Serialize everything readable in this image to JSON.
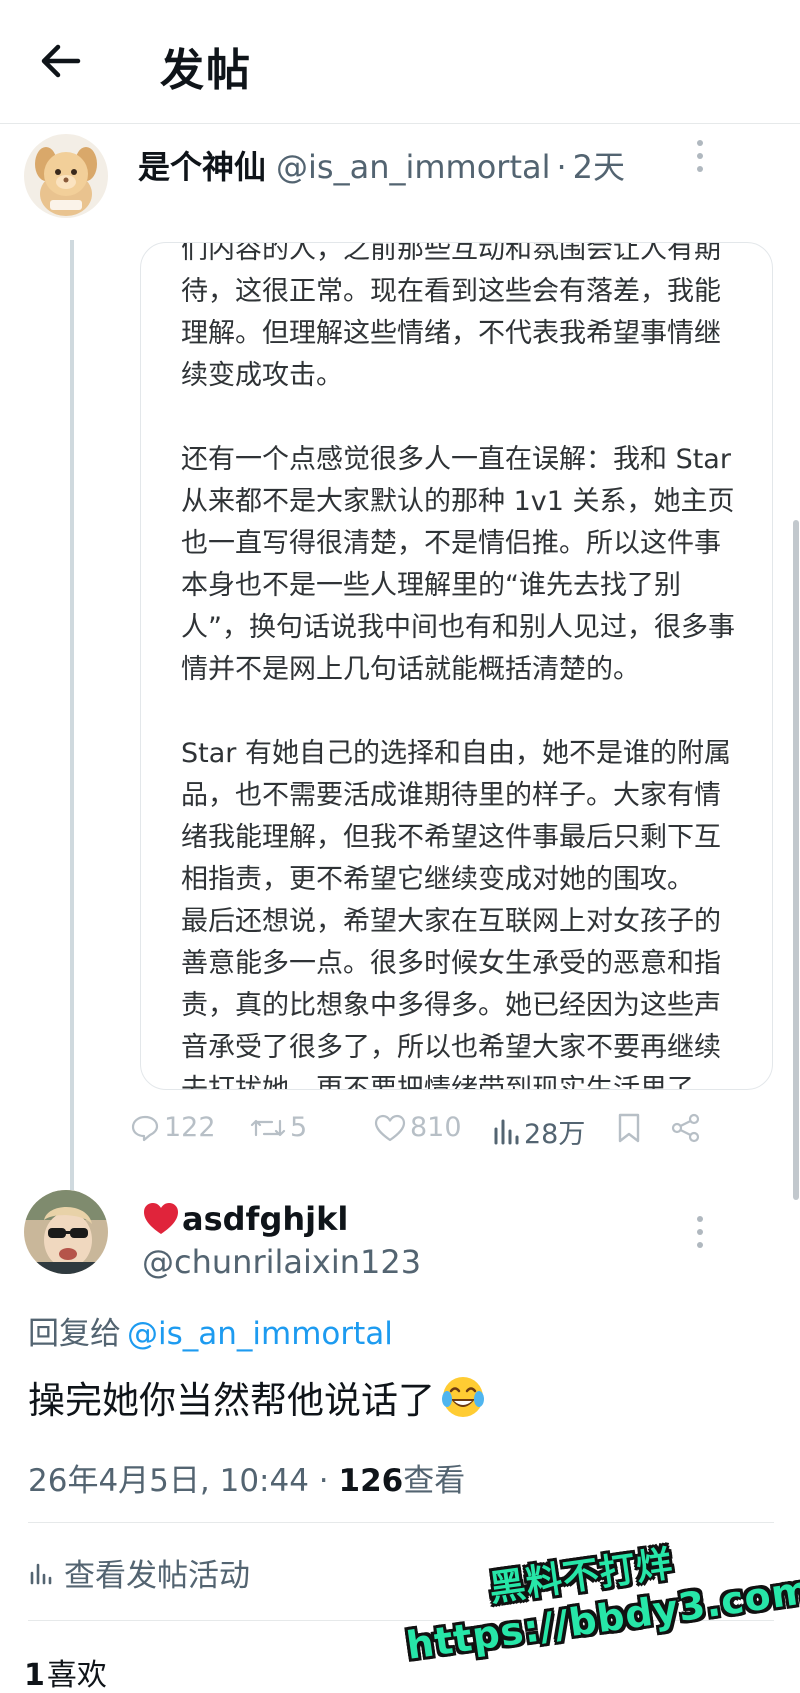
{
  "header": {
    "title": "发帖",
    "back_icon": "arrow-left-icon"
  },
  "original_post": {
    "display_name": "是个神仙",
    "handle": "@is_an_immortal",
    "separator": "·",
    "time": "2天",
    "quote_paragraphs": [
      "们内容的人，之前那些互动和氛围会让人有期待，这很正常。现在看到这些会有落差，我能理解。但理解这些情绪，不代表我希望事情继续变成攻击。",
      "还有一个点感觉很多人一直在误解：我和 Star 从来都不是大家默认的那种 1v1 关系，她主页也一直写得很清楚，不是情侣推。所以这件事本身也不是一些人理解里的“谁先去找了别人”，换句话说我中间也有和别人见过，很多事情并不是网上几句话就能概括清楚的。",
      "Star 有她自己的选择和自由，她不是谁的附属品，也不需要活成谁期待里的样子。大家有情绪我能理解，但我不希望这件事最后只剩下互相指责，更不希望它继续变成对她的围攻。",
      "最后还想说，希望大家在互联网上对女孩子的善意能多一点。很多时候女生承受的恶意和指责，真的比想象中多得多。她已经因为这些声音承受了很多了，所以也希望大家不要再继续去打扰她，更不要把情绪带到现实生活里了。"
    ],
    "actions": {
      "replies": "122",
      "reposts": "5",
      "likes": "810",
      "views": "28万"
    }
  },
  "reply": {
    "display_name": "asdfghjkl",
    "handle": "@chunrilaixin123",
    "reply_to_label": "回复给",
    "reply_to_handle": "@is_an_immortal",
    "text": "操完她你当然帮他说话了",
    "emoji": "face-with-tears-of-joy",
    "date": "26年4月5日, 10:44",
    "separator": "·",
    "views_count": "126",
    "views_label": "查看",
    "activity_label": "查看发帖活动",
    "likes_count": "1",
    "likes_label": "喜欢"
  },
  "watermark": {
    "line1": "黑料不打烊",
    "line2": "https://bbdy3.com"
  },
  "colors": {
    "link_blue": "#1d9bf0",
    "secondary_text": "#536471",
    "watermark_green": "#27e6a8",
    "heart_red": "#e0243b"
  }
}
